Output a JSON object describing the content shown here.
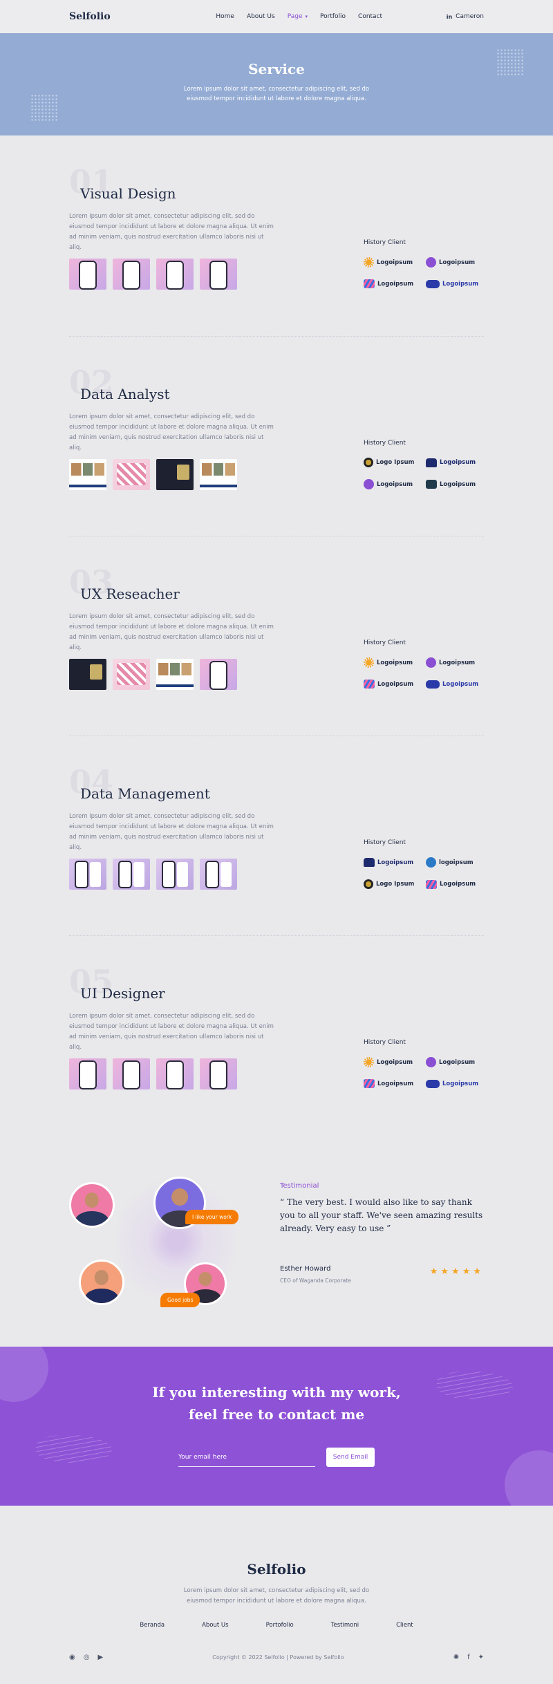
{
  "nav": {
    "brand": "Selfolio",
    "items": [
      "Home",
      "About Us",
      "Page",
      "Portfolio",
      "Contact"
    ],
    "user_name": "Cameron",
    "user_icon": "in"
  },
  "hero": {
    "title": "Service",
    "text": "Lorem ipsum dolor sit amet, consectetur adipiscing elit, sed do eiusmod tempor incididunt ut labore et dolore magna aliqua."
  },
  "services": [
    {
      "num": "01",
      "title": "Visual Design",
      "desc": "Lorem ipsum dolor sit amet, consectetur adipiscing elit, sed do eiusmod tempor incididunt ut labore et dolore magna aliqua. Ut enim ad minim veniam, quis nostrud exercitation ullamco laboris nisi ut aliq.",
      "clients_title": "History Client",
      "logos": [
        "Logoipsum",
        "Logoipsum",
        "Logoipsum",
        "Logoipsum"
      ]
    },
    {
      "num": "02",
      "title": "Data Analyst",
      "desc": "Lorem ipsum dolor sit amet, consectetur adipiscing elit, sed do eiusmod tempor incididunt ut labore et dolore magna aliqua. Ut enim ad minim veniam, quis nostrud exercitation ullamco laboris nisi ut aliq.",
      "clients_title": "History Client",
      "logos": [
        "Logo Ipsum",
        "Logoipsum",
        "Logoipsum",
        "Logoipsum"
      ]
    },
    {
      "num": "03",
      "title": "UX Reseacher",
      "desc": "Lorem ipsum dolor sit amet, consectetur adipiscing elit, sed do eiusmod tempor incididunt ut labore et dolore magna aliqua. Ut enim ad minim veniam, quis nostrud exercitation ullamco laboris nisi ut aliq.",
      "clients_title": "History Client",
      "logos": [
        "Logoipsum",
        "Logoipsum",
        "Logoipsum",
        "Logoipsum"
      ]
    },
    {
      "num": "04",
      "title": "Data Management",
      "desc": "Lorem ipsum dolor sit amet, consectetur adipiscing elit, sed do eiusmod tempor incididunt ut labore et dolore magna aliqua. Ut enim ad minim veniam, quis nostrud exercitation ullamco laboris nisi ut aliq.",
      "clients_title": "History Client",
      "logos": [
        "Logoipsum",
        "logoipsum",
        "Logo Ipsum",
        "Logoipsum"
      ]
    },
    {
      "num": "05",
      "title": "UI Designer",
      "desc": "Lorem ipsum dolor sit amet, consectetur adipiscing elit, sed do eiusmod tempor incididunt ut labore et dolore magna aliqua. Ut enim ad minim veniam, quis nostrud exercitation ullamco laboris nisi ut aliq.",
      "clients_title": "History Client",
      "logos": [
        "Logoipsum",
        "Logoipsum",
        "Logoipsum",
        "Logoipsum"
      ]
    }
  ],
  "testimonial": {
    "label": "Testimonial",
    "quote": "“ The very best. I would also like to say thank you to all your staff. We've seen amazing results already. Very easy to use ”",
    "name": "Esther Howard",
    "role": "CEO of Waganda Corporate",
    "rating": 5,
    "bubble_1": "I like your work",
    "bubble_2": "Good jobs"
  },
  "cta": {
    "title_line1": "If you interesting with my work,",
    "title_line2": "feel free to contact me",
    "email_placeholder": "Your email here",
    "button": "Send Email"
  },
  "footer": {
    "brand": "Selfolio",
    "desc": "Lorem ipsum dolor sit amet, consectetur adipiscing elit, sed do eiusmod tempor incididunt ut labore et dolore magna aliqua.",
    "links": [
      "Beranda",
      "About Us",
      "Portofolio",
      "Testimoni",
      "Client"
    ],
    "copyright": "Copyright © 2022 Selfolio | Powered by Selfolio",
    "socials_left": [
      "discord-icon",
      "instagram-icon",
      "youtube-icon"
    ],
    "socials_right": [
      "dribbble-icon",
      "facebook-icon",
      "twitter-icon"
    ]
  },
  "colors": {
    "accent": "#8e52d6",
    "hero_bg": "#94acd4",
    "bubble": "#f57c00",
    "star": "#f5a524"
  }
}
